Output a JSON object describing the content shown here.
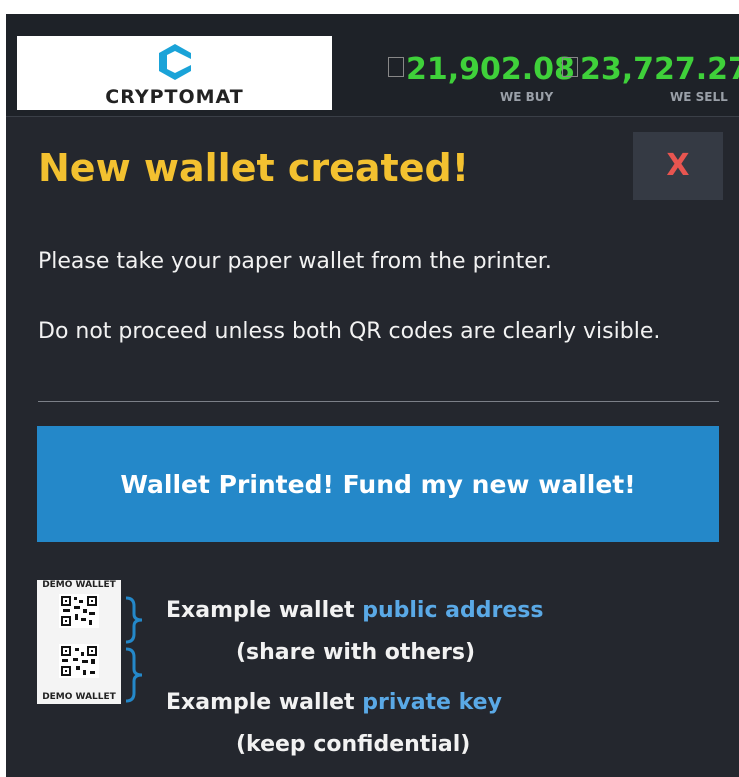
{
  "brand": {
    "name": "CRYPTOMAT",
    "logo_color": "#1aa3d8"
  },
  "prices": {
    "buy_value": "21,902.08",
    "buy_label": "WE BUY",
    "sell_value": "23,727.27",
    "sell_label": "WE SELL",
    "color": "#3fd13a"
  },
  "dialog": {
    "title": "New wallet created!",
    "close_label": "X",
    "message_1": "Please take your paper wallet from the printer.",
    "message_2": "Do not proceed unless both QR codes are clearly visible.",
    "primary_button": "Wallet Printed! Fund my new wallet!"
  },
  "example": {
    "paper_top_label": "DEMO WALLET",
    "paper_bottom_label": "DEMO WALLET",
    "public_prefix": "Example wallet ",
    "public_highlight": "public address",
    "public_note": "(share with others)",
    "private_prefix": "Example wallet ",
    "private_highlight": "private key",
    "private_note": "(keep confidential)",
    "highlight_color": "#5aa9e6"
  },
  "colors": {
    "background": "#24272e",
    "title": "#f3c130",
    "button": "#2488c9",
    "close": "#e85550"
  }
}
